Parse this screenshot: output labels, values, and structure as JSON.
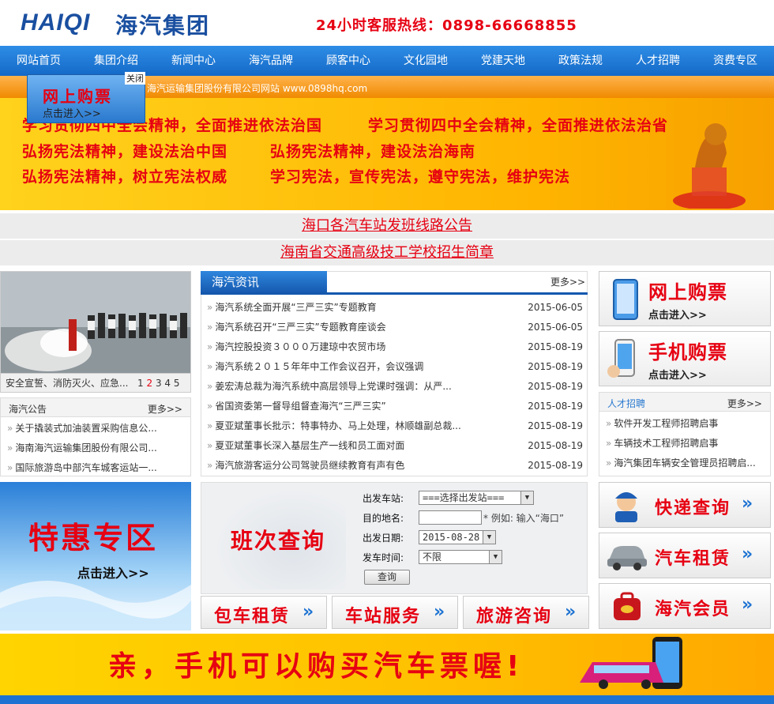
{
  "header": {
    "logo_en": "HAIQI",
    "logo_zh": "海汽集团",
    "hotline": "24小时客服热线：0898-66668855"
  },
  "nav": [
    "网站首页",
    "集团介绍",
    "新闻中心",
    "海汽品牌",
    "顾客中心",
    "文化园地",
    "党建天地",
    "政策法规",
    "人才招聘",
    "资费专区"
  ],
  "notice_bar": "海汽运输集团股份有限公司网站 www.0898hq.com",
  "float_ad": {
    "close": "关闭",
    "title": "网上购票",
    "sub": "点击进入>>"
  },
  "banner": {
    "line1a": "学习贯彻四中全会精神，全面推进依法治国",
    "line1b": "学习贯彻四中全会精神，全面推进依法治省",
    "line2a": "弘扬宪法精神，建设法治中国",
    "line2b": "弘扬宪法精神，建设法治海南",
    "line3a": "弘扬宪法精神，树立宪法权威",
    "line3b": "学习宪法，宣传宪法，遵守宪法，维护宪法"
  },
  "links": [
    "海口各汽车站发班线路公告",
    "海南省交通高级技工学校招生简章"
  ],
  "photo": {
    "caption": "安全宣誓、消防灭火、应急...",
    "pages": [
      "1",
      "2",
      "3",
      "4",
      "5"
    ],
    "current_page": "2"
  },
  "notices": {
    "title": "海汽公告",
    "more": "更多>>",
    "items": [
      "关于撬装式加油装置采购信息公...",
      "海南海汽运输集团股份有限公司...",
      "国际旅游岛中部汽车城客运站一..."
    ]
  },
  "news": {
    "title": "海汽资讯",
    "more": "更多>>",
    "items": [
      {
        "title": "海汽系统全面开展“三严三实”专题教育",
        "date": "2015-06-05"
      },
      {
        "title": "海汽系统召开“三严三实”专题教育座谈会",
        "date": "2015-06-05"
      },
      {
        "title": "海汽控股投资３０００万建琼中农贸市场",
        "date": "2015-08-19"
      },
      {
        "title": "海汽系统２０１５年年中工作会议召开，会议强调",
        "date": "2015-08-19"
      },
      {
        "title": "姜宏涛总裁为海汽系统中高层领导上党课时强调：从严...",
        "date": "2015-08-19"
      },
      {
        "title": "省国资委第一督导组督查海汽“三严三实”",
        "date": "2015-08-19"
      },
      {
        "title": "夏亚斌董事长批示：特事特办、马上处理，林顺雄副总裁...",
        "date": "2015-08-19"
      },
      {
        "title": "夏亚斌董事长深入基层生产一线和员工面对面",
        "date": "2015-08-19"
      },
      {
        "title": "海汽旅游客运分公司驾驶员继续教育有声有色",
        "date": "2015-08-19"
      }
    ]
  },
  "promos": [
    {
      "title": "网上购票",
      "sub": "点击进入>>",
      "icon": "tablet-icon"
    },
    {
      "title": "手机购票",
      "sub": "点击进入>>",
      "icon": "phone-icon"
    }
  ],
  "hiring": {
    "title": "人才招聘",
    "more": "更多>>",
    "items": [
      "软件开发工程师招聘启事",
      "车辆技术工程师招聘启事",
      "海汽集团车辆安全管理员招聘启..."
    ]
  },
  "special": {
    "title": "特惠专区",
    "sub": "点击进入>>"
  },
  "query": {
    "title": "班次查询",
    "depart_label": "出发车站:",
    "depart_value": "===选择出发站===",
    "dest_label": "目的地名:",
    "dest_hint": "* 例如: 输入“海口”",
    "date_label": "出发日期:",
    "date_value": "2015-08-28",
    "time_label": "发车时间:",
    "time_value": "不限",
    "submit": "查询"
  },
  "services": [
    "包车租赁",
    "车站服务",
    "旅游咨询"
  ],
  "right_buttons": [
    {
      "label": "快递查询",
      "icon": "courier-icon"
    },
    {
      "label": "汽车租赁",
      "icon": "car-icon"
    },
    {
      "label": "海汽会员",
      "icon": "vip-bag-icon"
    }
  ],
  "bottom_banner": "亲，手机可以购买汽车票喔!",
  "colors": {
    "brand_blue": "#1a4fa0",
    "nav_blue": "#1469c7",
    "accent_red": "#e60012",
    "banner_yellow": "#ffd21c"
  }
}
